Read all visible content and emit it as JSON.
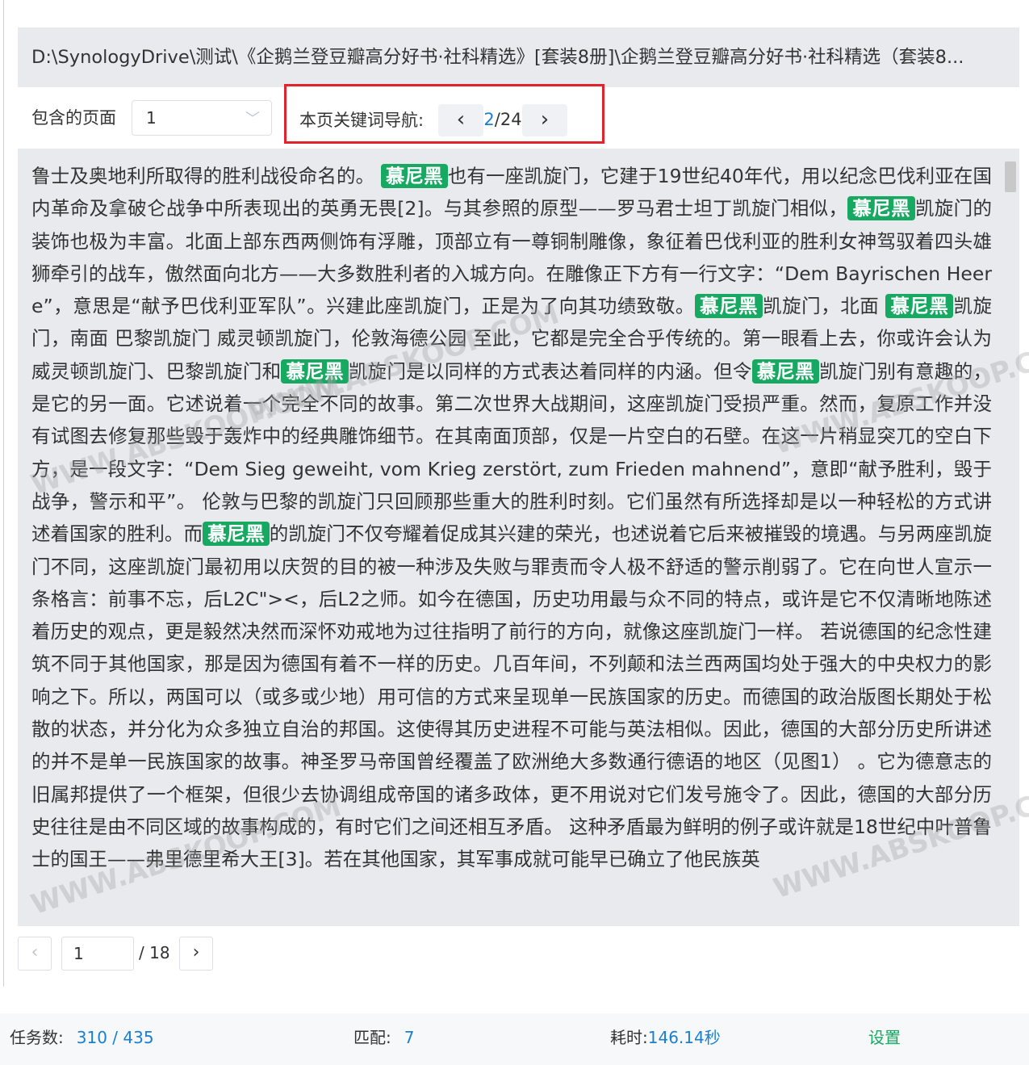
{
  "file_path": "D:\\SynologyDrive\\测试\\《企鹅兰登豆瓣高分好书·社科精选》[套装8册]\\企鹅兰登豆瓣高分好书·社科精选（套装8...",
  "controls": {
    "pages_label": "包含的页面",
    "pages_value": "1",
    "keyword_nav_label": "本页关键词导航:",
    "nav_current": "2",
    "nav_total": "/24"
  },
  "content": {
    "highlight_keyword": "慕尼黑",
    "segments": [
      "鲁士及奥地利所取得的胜利战役命名的。 ",
      "也有一座凯旋门，它建于19世纪40年代，用以纪念巴伐利亚在国内革命及拿破仑战争中所表现出的英勇无畏[2]。与其参照的原型——罗马君士坦丁凯旋门相似，",
      "凯旋门的装饰也极为丰富。北面上部东西两侧饰有浮雕，顶部立有一尊铜制雕像，象征着巴伐利亚的胜利女神驾驭着四头雄狮牵引的战车，傲然面向北方——大多数胜利者的入城方向。在雕像正下方有一行文字：“Dem Bayrischen Heere”，意思是“献予巴伐利亚军队”。兴建此座凯旋门，正是为了向其功绩致敬。",
      "凯旋门，北面 ",
      "凯旋门，南面 巴黎凯旋门 威灵顿凯旋门，伦敦海德公园 至此，它都是完全合乎传统的。第一眼看上去，你或许会认为威灵顿凯旋门、巴黎凯旋门和",
      "凯旋门是以同样的方式表达着同样的内涵。但令",
      "凯旋门别有意趣的，是它的另一面。它述说着一个完全不同的故事。第二次世界大战期间，这座凯旋门受损严重。然而，复原工作并没有试图去修复那些毁于轰炸中的经典雕饰细节。在其南面顶部，仅是一片空白的石壁。在这一片稍显突兀的空白下方，是一段文字：“Dem Sieg geweiht, vom Krieg zerstört, zum Frieden mahnend”，意即“献予胜利，毁于战争，警示和平”。 伦敦与巴黎的凯旋门只回顾那些重大的胜利时刻。它们虽然有所选择却是以一种轻松的方式讲述着国家的胜利。而",
      "的凯旋门不仅夸耀着促成其兴建的荣光，也述说着它后来被摧毁的境遇。与另两座凯旋门不同，这座凯旋门最初用以庆贺的目的被一种涉及失败与罪责而令人极不舒适的警示削弱了。它在向世人宣示一条格言：前事不忘，后L2C\"><，后L2之师。如今在德国，历史功用最与众不同的特点，或许是它不仅清晰地陈述着历史的观点，更是毅然决然而深怀劝戒地为过往指明了前行的方向，就像这座凯旋门一样。 若说德国的纪念性建筑不同于其他国家，那是因为德国有着不一样的历史。几百年间，不列颠和法兰西两国均处于强大的中央权力的影响之下。所以，两国可以（或多或少地）用可信的方式来呈现单一民族国家的历史。而德国的政治版图长期处于松散的状态，并分化为众多独立自治的邦国。这使得其历史进程不可能与英法相似。因此，德国的大部分历史所讲述的并不是单一民族国家的故事。神圣罗马帝国曾经覆盖了欧洲绝大多数通行德语的地区（见图1） 。它为德意志的旧属邦提供了一个框架，但很少去协调组成帝国的诸多政体，更不用说对它们发号施令了。因此，德国的大部分历史往往是由不同区域的故事构成的，有时它们之间还相互矛盾。 这种矛盾最为鲜明的例子或许就是18世纪中叶普鲁士的国王——弗里德里希大王[3]。若在其他国家，其军事成就可能早已确立了他民族英"
    ]
  },
  "pager": {
    "prev_icon": "chevron-left-icon",
    "next_icon": "chevron-right-icon",
    "page_input": "1",
    "total": "/ 18"
  },
  "status": {
    "tasks_label": "任务数:",
    "tasks_value": "310 / 435",
    "match_label": "匹配:",
    "match_value": "7",
    "time_label": "耗时:",
    "time_value": "146.14秒",
    "settings_label": "设置"
  },
  "watermark": "WWW.ABSKOOP.COM",
  "colors": {
    "highlight": "#17a862",
    "accent": "#1a7fd0",
    "frame_red": "#e0242e"
  }
}
